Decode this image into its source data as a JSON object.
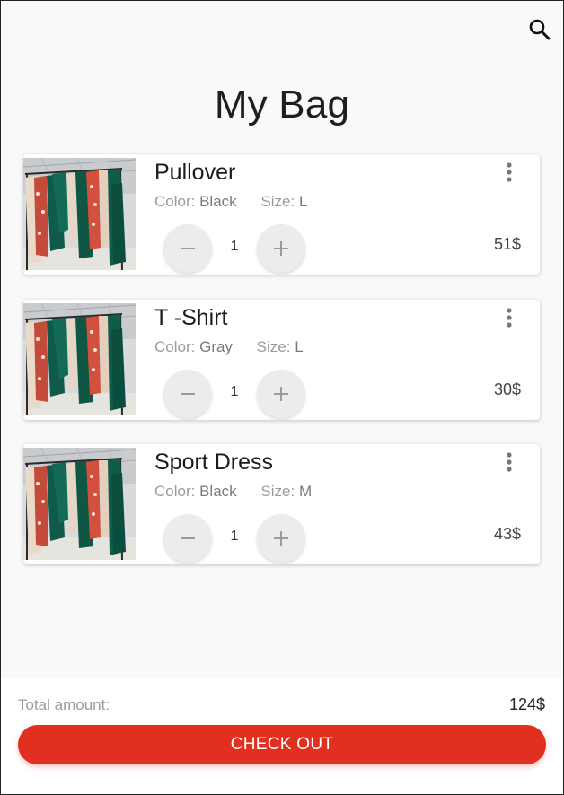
{
  "header": {
    "search_icon": "search-icon",
    "title": "My Bag"
  },
  "items": [
    {
      "name": "Pullover",
      "color_label": "Color:",
      "color": "Black",
      "size_label": "Size:",
      "size": "L",
      "quantity": "1",
      "price": "51$"
    },
    {
      "name": "T -Shirt",
      "color_label": "Color:",
      "color": "Gray",
      "size_label": "Size:",
      "size": "L",
      "quantity": "1",
      "price": "30$"
    },
    {
      "name": "Sport Dress",
      "color_label": "Color:",
      "color": "Black",
      "size_label": "Size:",
      "size": "M",
      "quantity": "1",
      "price": "43$"
    }
  ],
  "footer": {
    "total_label": "Total amount:",
    "total_value": "124$",
    "checkout_label": "CHECK OUT"
  },
  "colors": {
    "accent": "#e1301f",
    "background": "#f9f9f9",
    "card": "#ffffff"
  }
}
